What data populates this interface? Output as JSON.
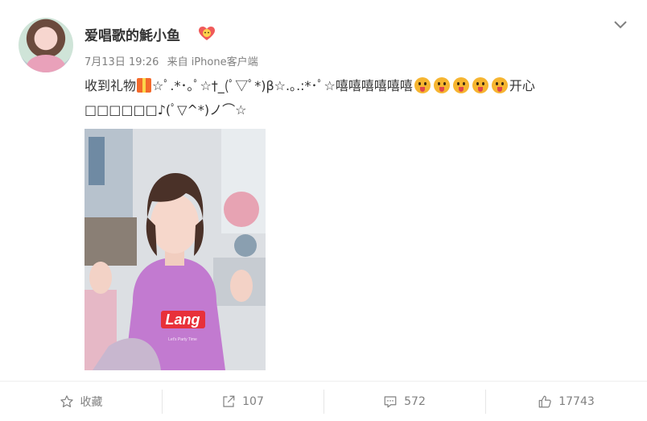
{
  "post": {
    "author": {
      "name": "爱唱歌的魹小鱼",
      "avatar": "avatar",
      "badge_icon": "fan-badge-icon"
    },
    "meta": {
      "date": "7月13日 19:26",
      "source": "来自 iPhone客户端"
    },
    "more_icon": "chevron-down-icon",
    "text": {
      "part1": "收到礼物",
      "part2": "☆ﾟ.*･｡ﾟ☆†_(ﾟ▽ﾟ*)β☆.｡.:*･ﾟ☆嘻嘻嘻嘻嘻嘻",
      "part3": "开心",
      "part4": "□□□□□□♪(ﾟ▽^*)ノ⌒☆"
    },
    "image": {
      "hoodie_text": "Lang",
      "hoodie_subtext": "Let's Party Time"
    }
  },
  "actions": {
    "favorite": {
      "label": "收藏",
      "icon": "star-icon"
    },
    "repost": {
      "label": "107",
      "icon": "share-icon"
    },
    "comment": {
      "label": "572",
      "icon": "comment-icon"
    },
    "like": {
      "label": "17743",
      "icon": "thumbs-up-icon"
    }
  },
  "colors": {
    "text": "#333333",
    "meta": "#808080",
    "hoodie": "#c27ad0",
    "hoodie_logo": "#e8303a"
  }
}
